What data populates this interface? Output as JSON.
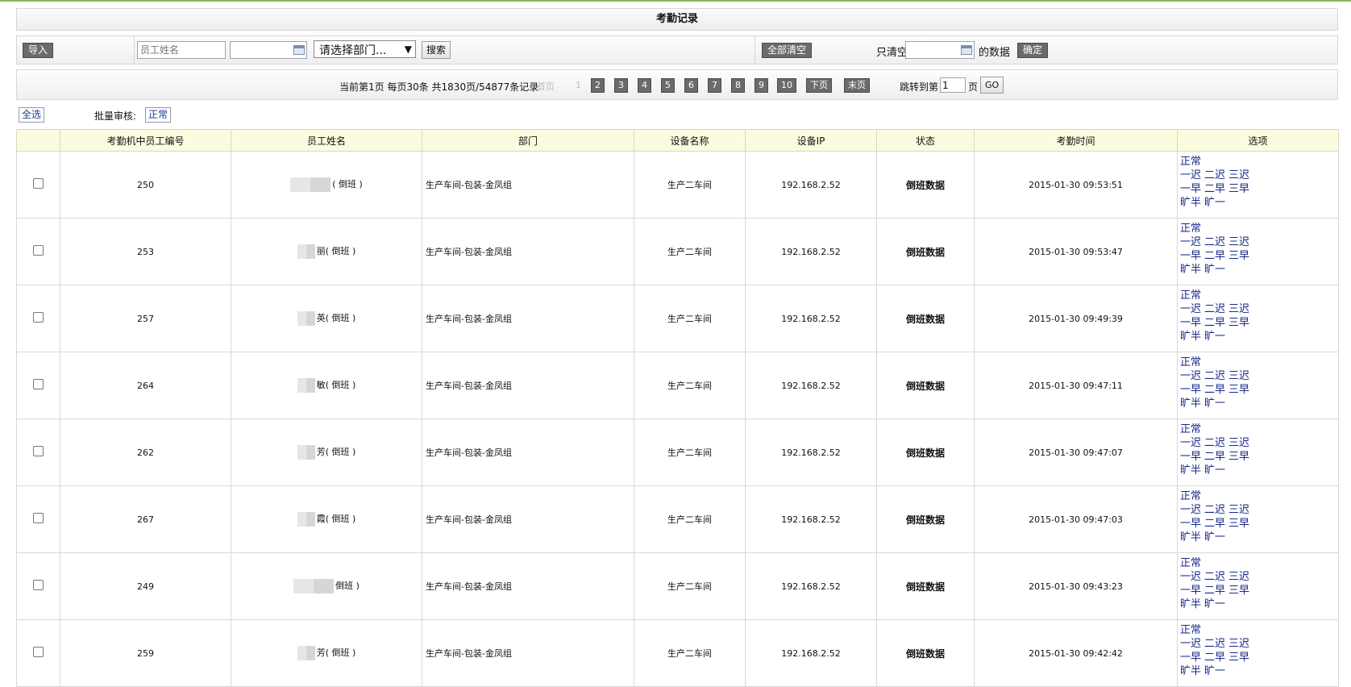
{
  "title": "考勤记录",
  "toolbar": {
    "import_label": "导入",
    "name_placeholder": "员工姓名",
    "dept_select": "请选择部门...",
    "search_label": "搜索",
    "clear_all_label": "全部清空",
    "clear_only_prefix": "只清空",
    "clear_only_suffix": "的数据",
    "confirm_label": "确定"
  },
  "pager": {
    "summary": "当前第1页  每页30条  共1830页/54877条记录",
    "first": "首页",
    "current": "1",
    "pages": [
      "2",
      "3",
      "4",
      "5",
      "6",
      "7",
      "8",
      "9",
      "10"
    ],
    "next": "下页",
    "last": "末页",
    "jump_prefix": "跳转到第",
    "jump_value": "1",
    "jump_suffix": "页",
    "go_label": "GO"
  },
  "batch": {
    "select_all": "全选",
    "approve_label": "批量审核:",
    "normal_label": "正常"
  },
  "table": {
    "headers": [
      "考勤机中员工编号",
      "员工姓名",
      "部门",
      "设备名称",
      "设备IP",
      "状态",
      "考勤时间",
      "选项"
    ],
    "options": {
      "line1": [
        "正常"
      ],
      "line2": [
        "一迟",
        "二迟",
        "三迟"
      ],
      "line3": [
        "一早",
        "二早",
        "三早"
      ],
      "line4": [
        "旷半",
        "旷一"
      ]
    },
    "rows": [
      {
        "id": "250",
        "name": "( 倒班 )",
        "name_char": "",
        "dept": "生产车间-包装-金凤组",
        "device": "生产二车间",
        "ip": "192.168.2.52",
        "status": "倒班数据",
        "time": "2015-01-30 09:53:51"
      },
      {
        "id": "253",
        "name": "( 倒班 )",
        "name_char": "丽",
        "dept": "生产车间-包装-金凤组",
        "device": "生产二车间",
        "ip": "192.168.2.52",
        "status": "倒班数据",
        "time": "2015-01-30 09:53:47"
      },
      {
        "id": "257",
        "name": "( 倒班 )",
        "name_char": "英",
        "dept": "生产车间-包装-金凤组",
        "device": "生产二车间",
        "ip": "192.168.2.52",
        "status": "倒班数据",
        "time": "2015-01-30 09:49:39"
      },
      {
        "id": "264",
        "name": "( 倒班 )",
        "name_char": "敏",
        "dept": "生产车间-包装-金凤组",
        "device": "生产二车间",
        "ip": "192.168.2.52",
        "status": "倒班数据",
        "time": "2015-01-30 09:47:11"
      },
      {
        "id": "262",
        "name": "( 倒班 )",
        "name_char": "芳",
        "dept": "生产车间-包装-金凤组",
        "device": "生产二车间",
        "ip": "192.168.2.52",
        "status": "倒班数据",
        "time": "2015-01-30 09:47:07"
      },
      {
        "id": "267",
        "name": "( 倒班 )",
        "name_char": "霞",
        "dept": "生产车间-包装-金凤组",
        "device": "生产二车间",
        "ip": "192.168.2.52",
        "status": "倒班数据",
        "time": "2015-01-30 09:47:03"
      },
      {
        "id": "249",
        "name": "倒班 )",
        "name_char": "",
        "dept": "生产车间-包装-金凤组",
        "device": "生产二车间",
        "ip": "192.168.2.52",
        "status": "倒班数据",
        "time": "2015-01-30 09:43:23"
      },
      {
        "id": "259",
        "name": "( 倒班 )",
        "name_char": "芳",
        "dept": "生产车间-包装-金凤组",
        "device": "生产二车间",
        "ip": "192.168.2.52",
        "status": "倒班数据",
        "time": "2015-01-30 09:42:42"
      }
    ]
  }
}
